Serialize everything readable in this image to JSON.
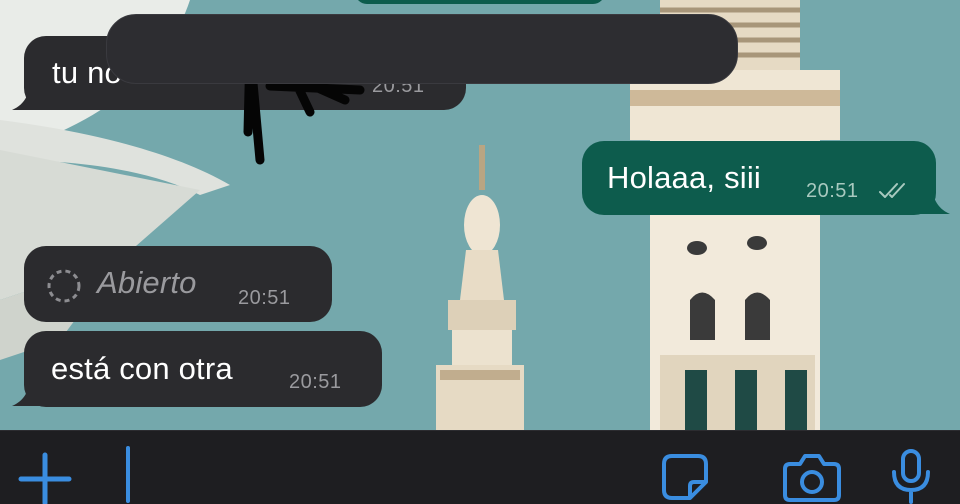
{
  "chat": {
    "messages": [
      {
        "direction": "incoming",
        "text": "tu novio es",
        "time": "20:51",
        "redacted": true
      },
      {
        "direction": "outgoing",
        "text": "Holaaa, siii",
        "time": "20:51",
        "status": "read"
      },
      {
        "direction": "incoming",
        "text": "Abierto",
        "time": "20:51",
        "kind": "view-once-opened"
      },
      {
        "direction": "incoming",
        "text": "está con otra",
        "time": "20:51"
      }
    ]
  },
  "input_bar": {
    "placeholder": "",
    "icons": [
      "plus-icon",
      "sticker-icon",
      "camera-icon",
      "microphone-icon"
    ]
  },
  "colors": {
    "incoming_bubble": "#2b2b2e",
    "outgoing_bubble": "#0d5c4d",
    "accent": "#3a8de0",
    "wallpaper_sky": "#6fa3a8"
  }
}
